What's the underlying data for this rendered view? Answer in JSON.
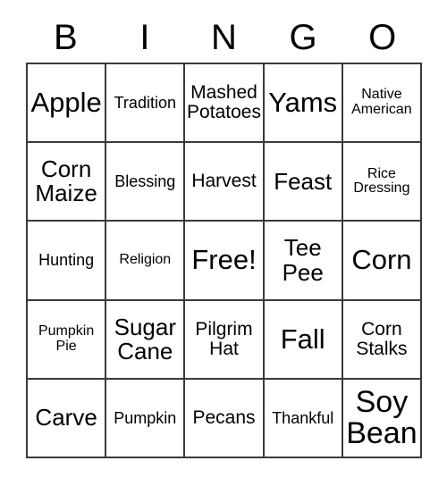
{
  "card": {
    "title": "Bingo Card",
    "header_letters": [
      "B",
      "I",
      "N",
      "G",
      "O"
    ],
    "columns": 5,
    "rows": 5,
    "border_color": "#3a3a3a",
    "background_color": "#ffffff",
    "text_color": "#000000",
    "free_space": "Free!",
    "cells": [
      [
        {
          "text": "Apple",
          "size": "lg"
        },
        {
          "text": "Tradition",
          "size": "xs"
        },
        {
          "text": "Mashed\nPotatoes",
          "size": "sm"
        },
        {
          "text": "Yams",
          "size": "lg"
        },
        {
          "text": "Native\nAmerican",
          "size": "xxs"
        }
      ],
      [
        {
          "text": "Corn\nMaize",
          "size": "md"
        },
        {
          "text": "Blessing",
          "size": "xs"
        },
        {
          "text": "Harvest",
          "size": "sm"
        },
        {
          "text": "Feast",
          "size": "md"
        },
        {
          "text": "Rice\nDressing",
          "size": "xxs"
        }
      ],
      [
        {
          "text": "Hunting",
          "size": "xs"
        },
        {
          "text": "Religion",
          "size": "xxs"
        },
        {
          "text": "Free!",
          "size": "lg"
        },
        {
          "text": "Tee\nPee",
          "size": "md"
        },
        {
          "text": "Corn",
          "size": "lg"
        }
      ],
      [
        {
          "text": "Pumpkin\nPie",
          "size": "xxs"
        },
        {
          "text": "Sugar\nCane",
          "size": "md"
        },
        {
          "text": "Pilgrim\nHat",
          "size": "sm"
        },
        {
          "text": "Fall",
          "size": "lg"
        },
        {
          "text": "Corn\nStalks",
          "size": "sm"
        }
      ],
      [
        {
          "text": "Carve",
          "size": "md"
        },
        {
          "text": "Pumpkin",
          "size": "xs"
        },
        {
          "text": "Pecans",
          "size": "sm"
        },
        {
          "text": "Thankful",
          "size": "xs"
        },
        {
          "text": "Soy\nBean",
          "size": "xl"
        }
      ]
    ]
  }
}
